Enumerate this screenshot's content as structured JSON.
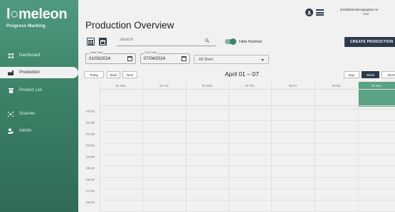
{
  "brand": {
    "logo_prefix": "l",
    "logo_mark": "○",
    "logo_rest": "meleon",
    "tagline": "Progress Marking"
  },
  "sidebar": {
    "items": [
      {
        "label": "Dashboard",
        "icon": "dashboard-icon",
        "active": false
      },
      {
        "label": "Production",
        "icon": "factory-icon",
        "active": true
      },
      {
        "label": "Product List",
        "icon": "box-icon",
        "active": false
      },
      {
        "label": "Scanner",
        "icon": "scanner-icon",
        "active": false
      },
      {
        "label": "Admin",
        "icon": "admin-icon",
        "active": false
      }
    ]
  },
  "header": {
    "title": "Production Overview",
    "user_email": "trond@kameleongruppen.no",
    "user_role": "User"
  },
  "toolbar": {
    "search_placeholder": "Search",
    "hide_finished_label": "Hide finished",
    "hide_finished_on": true,
    "create_label": "CREATE PRODUCTION"
  },
  "filters": {
    "start_label": "Start Time",
    "start_value": "01/03/2024",
    "end_label": "End Time",
    "end_value": "07/04/2024",
    "lines_value": "All lines"
  },
  "calendar": {
    "nav": {
      "today": "Today",
      "back": "Back",
      "next": "Next"
    },
    "range_title": "April 01 – 07",
    "views": [
      "Day",
      "Week",
      "Month"
    ],
    "active_view": "Week",
    "days": [
      "01 Mon",
      "02 Tue",
      "03 Wed",
      "04 Thu",
      "05 Fri",
      "06 Sat",
      "07 Sun"
    ],
    "selected_day": "07 Sun",
    "hours": [
      "00:00",
      "01:00",
      "02:00",
      "03:00",
      "04:00",
      "05:00",
      "06:00",
      "07:00",
      "08:00"
    ]
  },
  "colors": {
    "accent": "#3d8468",
    "dark": "#2d3a4a",
    "selected_day": "#5aa385"
  }
}
